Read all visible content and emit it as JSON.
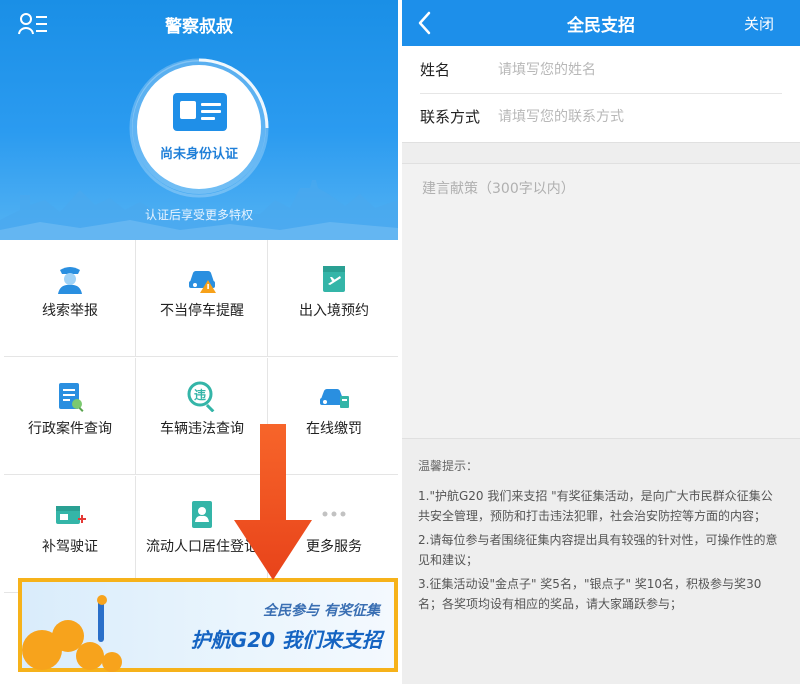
{
  "left": {
    "title": "警察叔叔",
    "auth_label": "尚未身份认证",
    "auth_subtitle": "认证后享受更多特权",
    "grid": [
      {
        "label": "线索举报",
        "icon": "police-officer-icon"
      },
      {
        "label": "不当停车提醒",
        "icon": "car-warning-icon"
      },
      {
        "label": "出入境预约",
        "icon": "airplane-ticket-icon"
      },
      {
        "label": "行政案件查询",
        "icon": "document-search-icon"
      },
      {
        "label": "车辆违法查询",
        "icon": "violation-search-icon"
      },
      {
        "label": "在线缴罚",
        "icon": "car-payment-icon"
      },
      {
        "label": "补驾驶证",
        "icon": "license-add-icon"
      },
      {
        "label": "流动人口居住登记",
        "icon": "resident-card-icon"
      },
      {
        "label": "更多服务",
        "icon": "more-dots-icon"
      }
    ],
    "banner": {
      "subtitle": "全民参与  有奖征集",
      "main": "护航G20 我们来支招"
    },
    "colors": {
      "header": "#1a8fe6",
      "accent": "#f6b21a",
      "arrow": "#f4511e"
    }
  },
  "right": {
    "title": "全民支招",
    "close_label": "关闭",
    "form": {
      "name_label": "姓名",
      "name_placeholder": "请填写您的姓名",
      "contact_label": "联系方式",
      "contact_placeholder": "请填写您的联系方式",
      "suggestion_placeholder": "建言献策（300字以内）"
    },
    "tips": {
      "title": "温馨提示：",
      "items": [
        "1.\"护航G20 我们来支招 \"有奖征集活动，是向广大市民群众征集公共安全管理，预防和打击违法犯罪，社会治安防控等方面的内容；",
        "2.请每位参与者围绕征集内容提出具有较强的针对性，可操作性的意见和建议；",
        "3.征集活动设\"金点子\" 奖5名，\"银点子\" 奖10名，积极参与奖30名；各奖项均设有相应的奖品，请大家踊跃参与；"
      ]
    }
  }
}
